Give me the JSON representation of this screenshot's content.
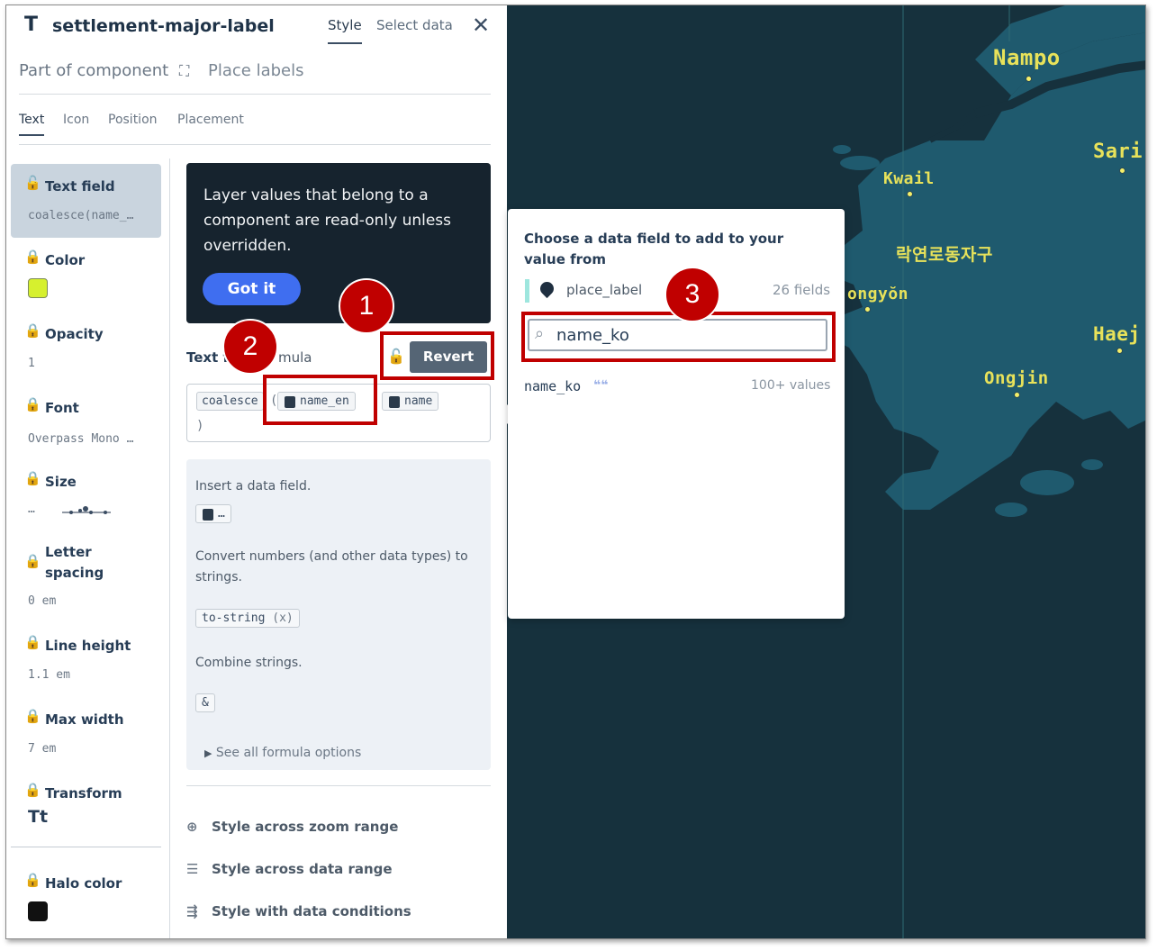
{
  "header": {
    "layer_type_icon": "T",
    "title": "settlement-major-label",
    "tabs": [
      {
        "label": "Style",
        "active": true
      },
      {
        "label": "Select data",
        "active": false
      }
    ],
    "close_icon": "close-icon"
  },
  "component": {
    "label": "Part of component",
    "name": "Place labels",
    "icon": "component-icon"
  },
  "sub_tabs": [
    {
      "label": "Text",
      "active": true
    },
    {
      "label": "Icon",
      "active": false
    },
    {
      "label": "Position",
      "active": false
    },
    {
      "label": "Placement",
      "active": false
    }
  ],
  "properties": [
    {
      "name": "Text field",
      "value": "coalesce(name_…",
      "locked": false,
      "active": true
    },
    {
      "name": "Color",
      "swatch": "#d6f02e",
      "locked": true
    },
    {
      "name": "Opacity",
      "value": "1",
      "locked": true
    },
    {
      "name": "Font",
      "value": "Overpass Mono …",
      "locked": true
    },
    {
      "name": "Size",
      "value": "…",
      "locked": true
    },
    {
      "name": "Letter spacing",
      "value": "0 em",
      "locked": true
    },
    {
      "name": "Line height",
      "value": "1.1 em",
      "locked": true
    },
    {
      "name": "Max width",
      "value": "7 em",
      "locked": true
    },
    {
      "name": "Transform",
      "value": "Tt",
      "locked": true
    },
    {
      "name": "Halo color",
      "swatch": "#111111",
      "locked": true
    }
  ],
  "notice": {
    "text": "Layer values that belong to a component are read-only unless overridden.",
    "button": "Got it"
  },
  "text_field": {
    "label": "Text f",
    "label_suffix": "mula",
    "revert": "Revert",
    "formula": {
      "fn": "coalesce",
      "fields": [
        "name_en",
        "name"
      ],
      "close": ")"
    }
  },
  "help": {
    "insert_text": "Insert a data field.",
    "insert_chip": "…",
    "convert_text": "Convert numbers (and other data types) to strings.",
    "convert_chip": "to-string",
    "convert_arg": "(x)",
    "combine_text": "Combine strings.",
    "combine_chip": "&",
    "see_all": "See all formula options"
  },
  "style_options": [
    {
      "label": "Style across zoom range",
      "icon": "zoom-range-icon"
    },
    {
      "label": "Style across data range",
      "icon": "data-range-icon"
    },
    {
      "label": "Style with data conditions",
      "icon": "data-conditions-icon"
    }
  ],
  "popup": {
    "title": "Choose a data field to add to your value from",
    "source": "place_label",
    "field_count": "26 fields",
    "search_value": "name_ko",
    "result_name": "name_ko",
    "result_values": "100+ values"
  },
  "map_labels": [
    "Nampo",
    "Sari",
    "Kwail",
    "락연로동자구",
    "ongyŏn",
    "Haej",
    "Ongjin"
  ],
  "annotations": [
    "1",
    "2",
    "3"
  ],
  "colors": {
    "accent_blue": "#3f6ef0",
    "annotation_red": "#c00000",
    "map_bg": "#16313d",
    "land": "#1f5a6e",
    "label_yellow": "#e8e25a"
  }
}
